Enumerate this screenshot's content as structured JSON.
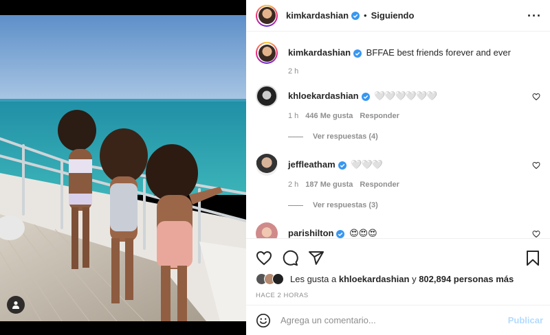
{
  "post": {
    "author": "kimkardashian",
    "follow_status": "Siguiendo",
    "more_icon": "more-icon",
    "caption_text": "BFFAE best friends forever and ever",
    "caption_time": "2 h"
  },
  "comments": [
    {
      "user": "khloekardashian",
      "text": "🤍🤍🤍🤍🤍🤍",
      "time": "1 h",
      "likes": "446 Me gusta",
      "reply": "Responder",
      "view_replies": "Ver respuestas (4)"
    },
    {
      "user": "jeffleatham",
      "text": "🤍🤍🤍",
      "time": "2 h",
      "likes": "187 Me gusta",
      "reply": "Responder",
      "view_replies": "Ver respuestas (3)"
    },
    {
      "user": "parishilton",
      "text": "😍😍😍"
    }
  ],
  "likes": {
    "prefix": "Les gusta a",
    "user": "khloekardashian",
    "connector": "y",
    "others": "802,894 personas más"
  },
  "timestamp": "HACE 2 HORAS",
  "add_comment": {
    "placeholder": "Agrega un comentario...",
    "publish_label": "Publicar"
  },
  "colors": {
    "verified": "#3897f0",
    "publish_disabled": "#b3dbff",
    "muted": "#8e8e8e"
  }
}
